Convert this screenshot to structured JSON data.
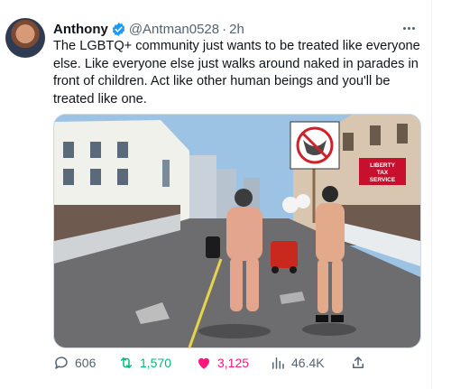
{
  "author": {
    "name": "Anthony",
    "handle": "@Antman0528",
    "separator": "·",
    "time": "2h"
  },
  "tweet": {
    "text": "The LGBTQ+ community just wants to be treated like everyone else. Like everyone else just walks around naked in parades in front of children. Act like other human beings and you'll be treated like one."
  },
  "photo": {
    "signs": [
      "LIBERTY",
      "TAX",
      "SERVICE"
    ]
  },
  "actions": {
    "replies": "606",
    "retweets": "1,570",
    "likes": "3,125",
    "views": "46.4K"
  },
  "colors": {
    "verified": "#1d9bf0",
    "retweet_active": "#00ba7c",
    "like_active": "#f91880",
    "muted": "#536471"
  },
  "icons": [
    "verified-badge-icon",
    "more-options-icon",
    "reply-icon",
    "retweet-icon",
    "like-icon",
    "views-icon",
    "share-icon"
  ]
}
